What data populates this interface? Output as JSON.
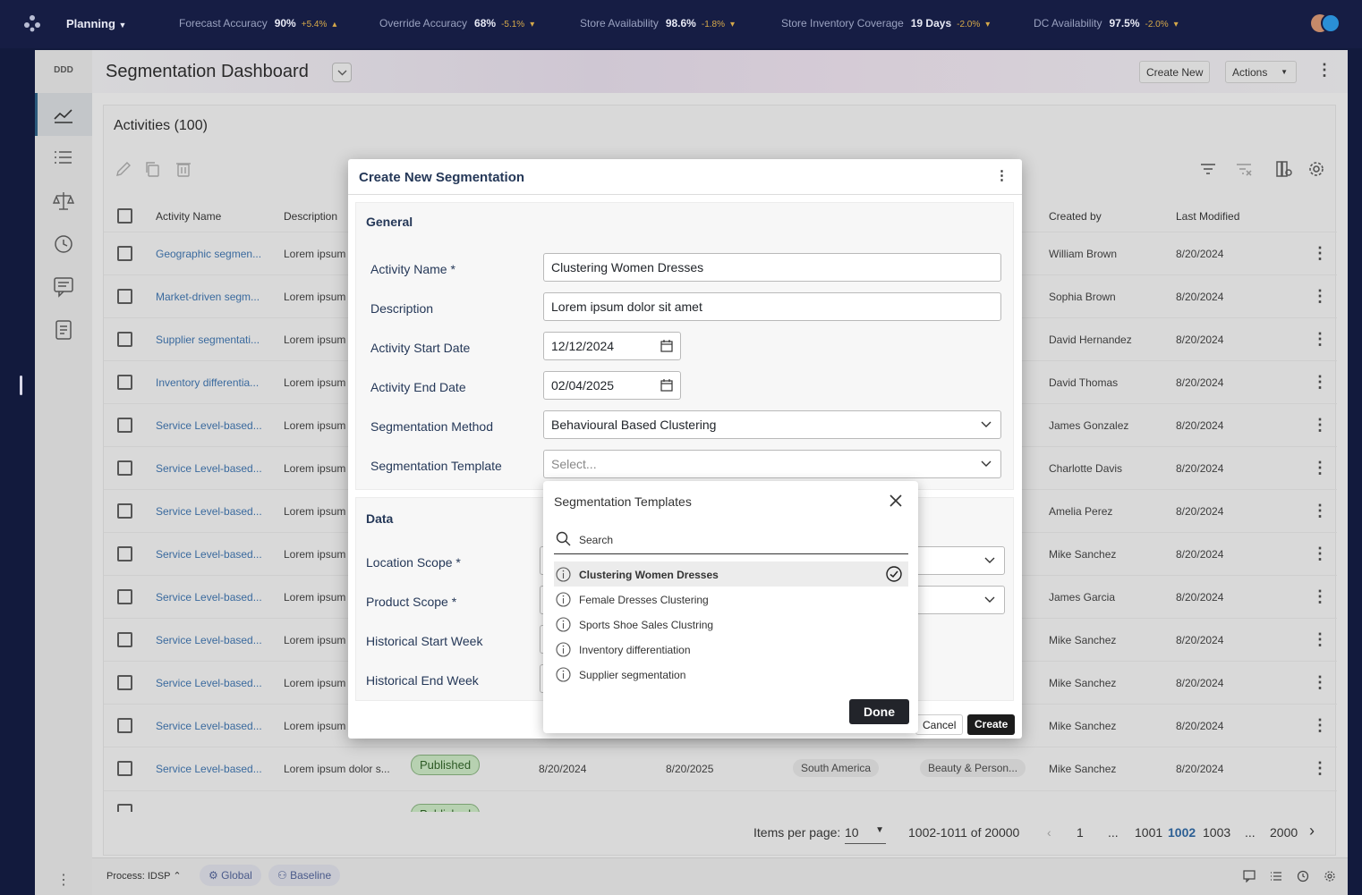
{
  "topbar": {
    "app_menu": "Planning",
    "kpis": [
      {
        "label": "Forecast Accuracy",
        "value": "90%",
        "delta": "+5.4%"
      },
      {
        "label": "Override Accuracy",
        "value": "68%",
        "delta": "-5.1%"
      },
      {
        "label": "Store Availability",
        "value": "98.6%",
        "delta": "-1.8%"
      },
      {
        "label": "Store Inventory Coverage",
        "value": "19 Days",
        "delta": "-2.0%"
      },
      {
        "label": "DC Availability",
        "value": "97.5%",
        "delta": "-2.0%"
      }
    ]
  },
  "sidebar": {
    "brand": "DDD"
  },
  "header": {
    "title": "Segmentation Dashboard",
    "create_new": "Create New",
    "actions": "Actions"
  },
  "activities": {
    "title": "Activities (100)",
    "columns": {
      "name": "Activity Name",
      "description": "Description",
      "created_by": "Created by",
      "last_modified": "Last Modified"
    },
    "rows": [
      {
        "name": "Geographic segmen...",
        "description": "Lorem ipsum",
        "created_by": "William Brown",
        "last_modified": "8/20/2024"
      },
      {
        "name": "Market-driven segm...",
        "description": "Lorem ipsum",
        "created_by": "Sophia Brown",
        "last_modified": "8/20/2024"
      },
      {
        "name": "Supplier segmentati...",
        "description": "Lorem ipsum",
        "created_by": "David Hernandez",
        "last_modified": "8/20/2024"
      },
      {
        "name": "Inventory differentia...",
        "description": "Lorem ipsum",
        "created_by": "David Thomas",
        "last_modified": "8/20/2024"
      },
      {
        "name": "Service Level-based...",
        "description": "Lorem ipsum",
        "created_by": "James Gonzalez",
        "last_modified": "8/20/2024"
      },
      {
        "name": "Service Level-based...",
        "description": "Lorem ipsum",
        "created_by": "Charlotte Davis",
        "last_modified": "8/20/2024"
      },
      {
        "name": "Service Level-based...",
        "description": "Lorem ipsum",
        "created_by": "Amelia Perez",
        "last_modified": "8/20/2024"
      },
      {
        "name": "Service Level-based...",
        "description": "Lorem ipsum",
        "created_by": "Mike Sanchez",
        "last_modified": "8/20/2024"
      },
      {
        "name": "Service Level-based...",
        "description": "Lorem ipsum",
        "created_by": "James Garcia",
        "last_modified": "8/20/2024"
      },
      {
        "name": "Service Level-based...",
        "description": "Lorem ipsum",
        "created_by": "Mike Sanchez",
        "last_modified": "8/20/2024"
      },
      {
        "name": "Service Level-based...",
        "description": "Lorem ipsum",
        "created_by": "Mike Sanchez",
        "last_modified": "8/20/2024"
      },
      {
        "name": "Service Level-based...",
        "description": "Lorem ipsum",
        "created_by": "Mike Sanchez",
        "last_modified": "8/20/2024"
      }
    ],
    "full_row": {
      "name": "Service Level-based...",
      "description": "Lorem ipsum dolor s...",
      "status": "Published",
      "start": "8/20/2024",
      "end": "8/20/2025",
      "region": "South America",
      "category": "Beauty & Person...",
      "created_by": "Mike Sanchez",
      "last_modified": "8/20/2024"
    },
    "partial_status": "Published"
  },
  "pagination": {
    "items_label": "Items per page:",
    "items_value": "10",
    "range": "1002-1011 of 20000",
    "first": "1",
    "ellipsis": "...",
    "pages": [
      "1001",
      "1002",
      "1003"
    ],
    "last": "2000"
  },
  "footer": {
    "process": "Process: IDSP",
    "chip_global": "Global",
    "chip_baseline": "Baseline"
  },
  "modal": {
    "title": "Create New Segmentation",
    "general_title": "General",
    "data_title": "Data",
    "fields": {
      "activity_name_label": "Activity Name *",
      "activity_name_value": "Clustering Women Dresses",
      "description_label": "Description",
      "description_value": "Lorem ipsum dolor sit amet",
      "start_label": "Activity Start Date",
      "start_value": "12/12/2024",
      "end_label": "Activity End Date",
      "end_value": "02/04/2025",
      "method_label": "Segmentation Method",
      "method_value": "Behavioural Based Clustering",
      "template_label": "Segmentation Template",
      "template_placeholder": "Select...",
      "location_label": "Location Scope *",
      "product_label": "Product Scope *",
      "hist_start_label": "Historical Start Week",
      "hist_end_label": "Historical End Week"
    },
    "cancel": "Cancel",
    "create": "Create"
  },
  "popup": {
    "title": "Segmentation Templates",
    "search_placeholder": "Search",
    "items": [
      "Clustering Women Dresses",
      "Female Dresses Clustering",
      "Sports Shoe Sales Clustring",
      "Inventory differentiation",
      "Supplier segmentation"
    ],
    "selected": "Clustering Women Dresses",
    "done": "Done"
  },
  "colors": {
    "accent": "#2b5a7c",
    "link": "#3a6a9e",
    "topbar": "#161d44",
    "published": "#b7d1b1"
  }
}
